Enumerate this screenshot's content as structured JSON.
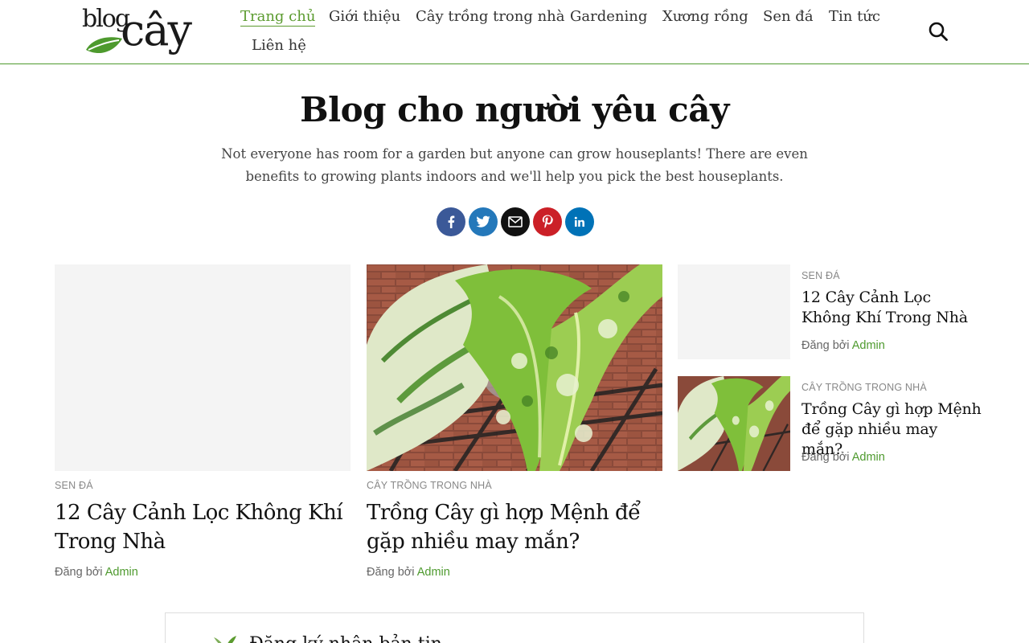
{
  "logo": {
    "part1": "blog",
    "part2": "cây"
  },
  "nav": {
    "items": [
      {
        "label": "Trang chủ",
        "active": true
      },
      {
        "label": "Giới thiệu"
      },
      {
        "label": "Cây trồng trong nhà"
      },
      {
        "label": "Gardening"
      },
      {
        "label": "Xương rồng"
      },
      {
        "label": "Sen đá"
      },
      {
        "label": "Tin tức"
      },
      {
        "label": "Liên hệ"
      }
    ],
    "search_icon": "search-icon"
  },
  "hero": {
    "title": "Blog cho người yêu cây",
    "description": "Not everyone has room for a garden but anyone can grow houseplants! There are even benefits to growing plants indoors and we'll help you pick the best houseplants."
  },
  "share": [
    {
      "icon": "facebook-icon",
      "color": "#3b5998"
    },
    {
      "icon": "twitter-icon",
      "color": "#2478ba"
    },
    {
      "icon": "email-icon",
      "color": "#111111"
    },
    {
      "icon": "pinterest-icon",
      "color": "#cb2027"
    },
    {
      "icon": "linkedin-icon",
      "color": "#0072b7"
    }
  ],
  "posts": [
    {
      "category": "SEN ĐÁ",
      "title": "12 Cây Cảnh Lọc Không Khí Trong Nhà",
      "posted_by": "Đăng bởi",
      "author": "Admin"
    },
    {
      "category": "CÂY TRỒNG TRONG NHÀ",
      "title": "Trồng Cây gì hợp Mệnh để gặp nhiều may mắn?",
      "posted_by": "Đăng bởi",
      "author": "Admin"
    }
  ],
  "side_posts": [
    {
      "category": "SEN ĐÁ",
      "title": "12 Cây Cảnh Lọc Không Khí Trong Nhà",
      "posted_by": "Đăng bởi",
      "author": "Admin"
    },
    {
      "category": "CÂY TRỒNG TRONG NHÀ",
      "title": "Trồng Cây gì hợp Mệnh để gặp nhiều may mắn?",
      "posted_by": "Đăng bởi",
      "author": "Admin"
    }
  ],
  "newsletter": {
    "title": "Đăng ký nhận bản tin"
  },
  "colors": {
    "accent": "#4e9a2e",
    "text": "#111111",
    "muted": "#888888"
  }
}
